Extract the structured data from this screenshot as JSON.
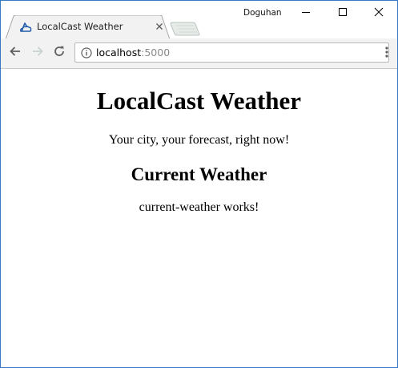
{
  "browser": {
    "tab": {
      "title": "LocalCast Weather",
      "favicon": "angular-cloud-icon"
    },
    "profile_name": "Doguhan",
    "window_controls": [
      "minimize-icon",
      "maximize-icon",
      "close-icon"
    ],
    "address_bar": {
      "host": "localhost",
      "port": ":5000",
      "security_icon": "info-icon"
    },
    "nav_icons": [
      "back-arrow-icon",
      "forward-arrow-icon",
      "reload-icon"
    ],
    "menu_icon": "kebab-menu-icon"
  },
  "page": {
    "heading": "LocalCast Weather",
    "tagline": "Your city, your forecast, right now!",
    "section_heading": "Current Weather",
    "component_text": "current-weather works!"
  },
  "colors": {
    "window_border": "#3a78c3",
    "toolbar_bg": "#f2f2f2",
    "tab_bg": "#f2f2f2",
    "favicon": "#1e5aa8",
    "port_text": "#8a8a8a"
  }
}
